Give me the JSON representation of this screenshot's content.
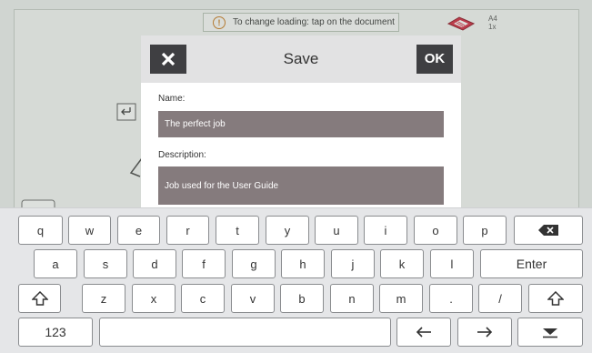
{
  "background": {
    "hint_text": "To change loading: tap on the document",
    "hint_icon": "info-icon",
    "paper_size": "A4",
    "copies": "1x"
  },
  "dialog": {
    "title": "Save",
    "ok_label": "OK",
    "close_icon": "close-icon",
    "name_label": "Name:",
    "name_value": "The perfect job",
    "description_label": "Description:",
    "description_value": "Job used for the User Guide",
    "header_bg": "#e2e2e3",
    "button_bg": "#3f3f42",
    "field_bg": "#857b7d"
  },
  "keyboard": {
    "row1": [
      "q",
      "w",
      "e",
      "r",
      "t",
      "y",
      "u",
      "i",
      "o",
      "p"
    ],
    "row2": [
      "a",
      "s",
      "d",
      "f",
      "g",
      "h",
      "j",
      "k",
      "l"
    ],
    "enter_label": "Enter",
    "row3": [
      "z",
      "x",
      "c",
      "v",
      "b",
      "n",
      "m",
      ".",
      "/"
    ],
    "numbers_label": "123",
    "backspace_icon": "backspace-icon",
    "shift_icon": "shift-icon",
    "left_arrow_icon": "arrow-left-icon",
    "right_arrow_icon": "arrow-right-icon",
    "hide_icon": "hide-keyboard-icon"
  }
}
